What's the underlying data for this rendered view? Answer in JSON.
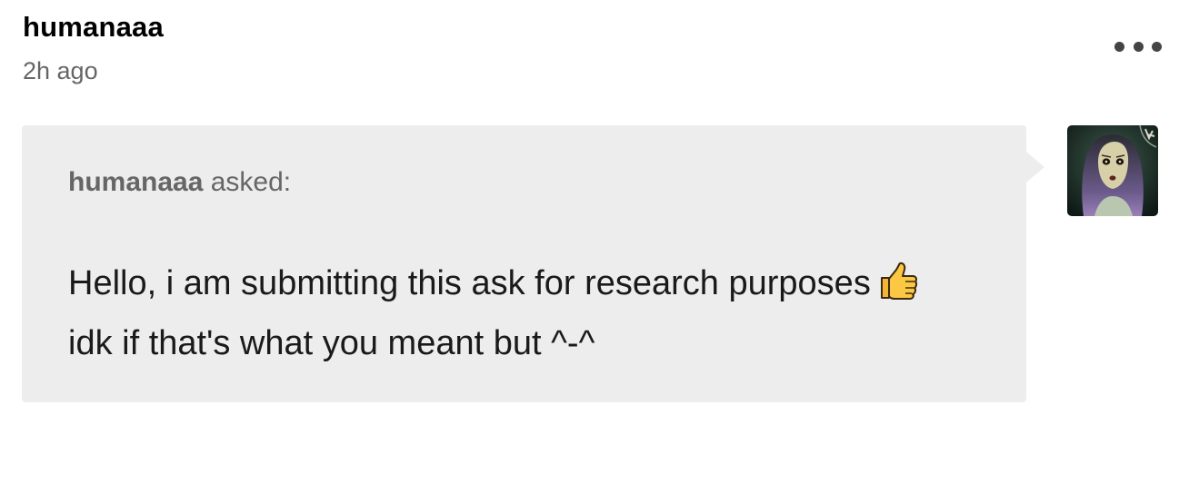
{
  "post": {
    "username": "humanaaa",
    "timestamp": "2h ago",
    "menu_icon": "more-horizontal-icon"
  },
  "ask": {
    "asker": "humanaaa",
    "asked_label": "asked:",
    "question_line1": "Hello, i am submitting this ask for research purposes",
    "question_line2": "idk if that's what you meant but ^-^",
    "emoji_icon": "thumbs-up-emoji-icon",
    "background_color": "#ededed"
  },
  "avatar": {
    "icon": "asker-avatar-icon"
  }
}
